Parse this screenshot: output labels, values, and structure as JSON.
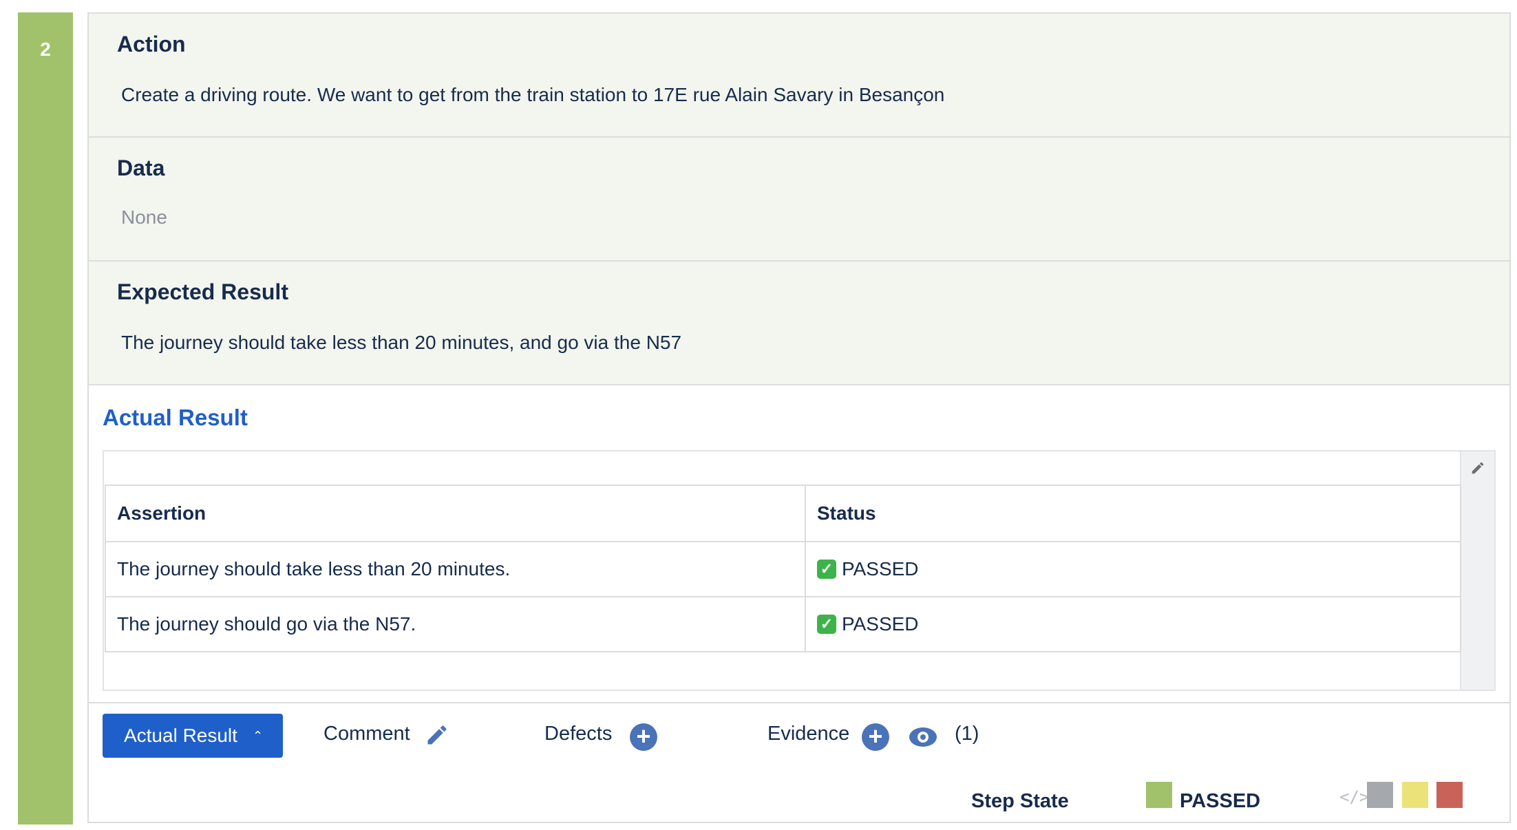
{
  "step": {
    "number": "2",
    "color": "#a1c26b"
  },
  "sections": {
    "action": {
      "title": "Action",
      "body": "Create a driving route. We want to get from the train station to 17E rue Alain Savary in Besançon"
    },
    "data": {
      "title": "Data",
      "body": "None"
    },
    "expected": {
      "title": "Expected Result",
      "body": "The journey should take less than 20 minutes, and go via the N57"
    }
  },
  "actual_result": {
    "title": "Actual Result",
    "table": {
      "headers": [
        "Assertion",
        "Status"
      ],
      "rows": [
        {
          "assertion": "The journey should take less than 20 minutes.",
          "status": "PASSED"
        },
        {
          "assertion": "The journey should go via the N57.",
          "status": "PASSED"
        }
      ]
    }
  },
  "toolbar": {
    "actual_result_label": "Actual Result",
    "comment_label": "Comment",
    "defects_label": "Defects",
    "evidence_label": "Evidence",
    "evidence_count": "(1)"
  },
  "step_state": {
    "label": "Step State",
    "value": "PASSED",
    "colors": {
      "passed": "#a1c26b",
      "todo": "#a5a8ad",
      "executing": "#ece27a",
      "failed": "#c9635a"
    }
  },
  "icons": [
    "edit-pencil-icon",
    "add-circle-icon",
    "eye-icon",
    "code-icon",
    "check-icon",
    "chevron-up-icon"
  ]
}
